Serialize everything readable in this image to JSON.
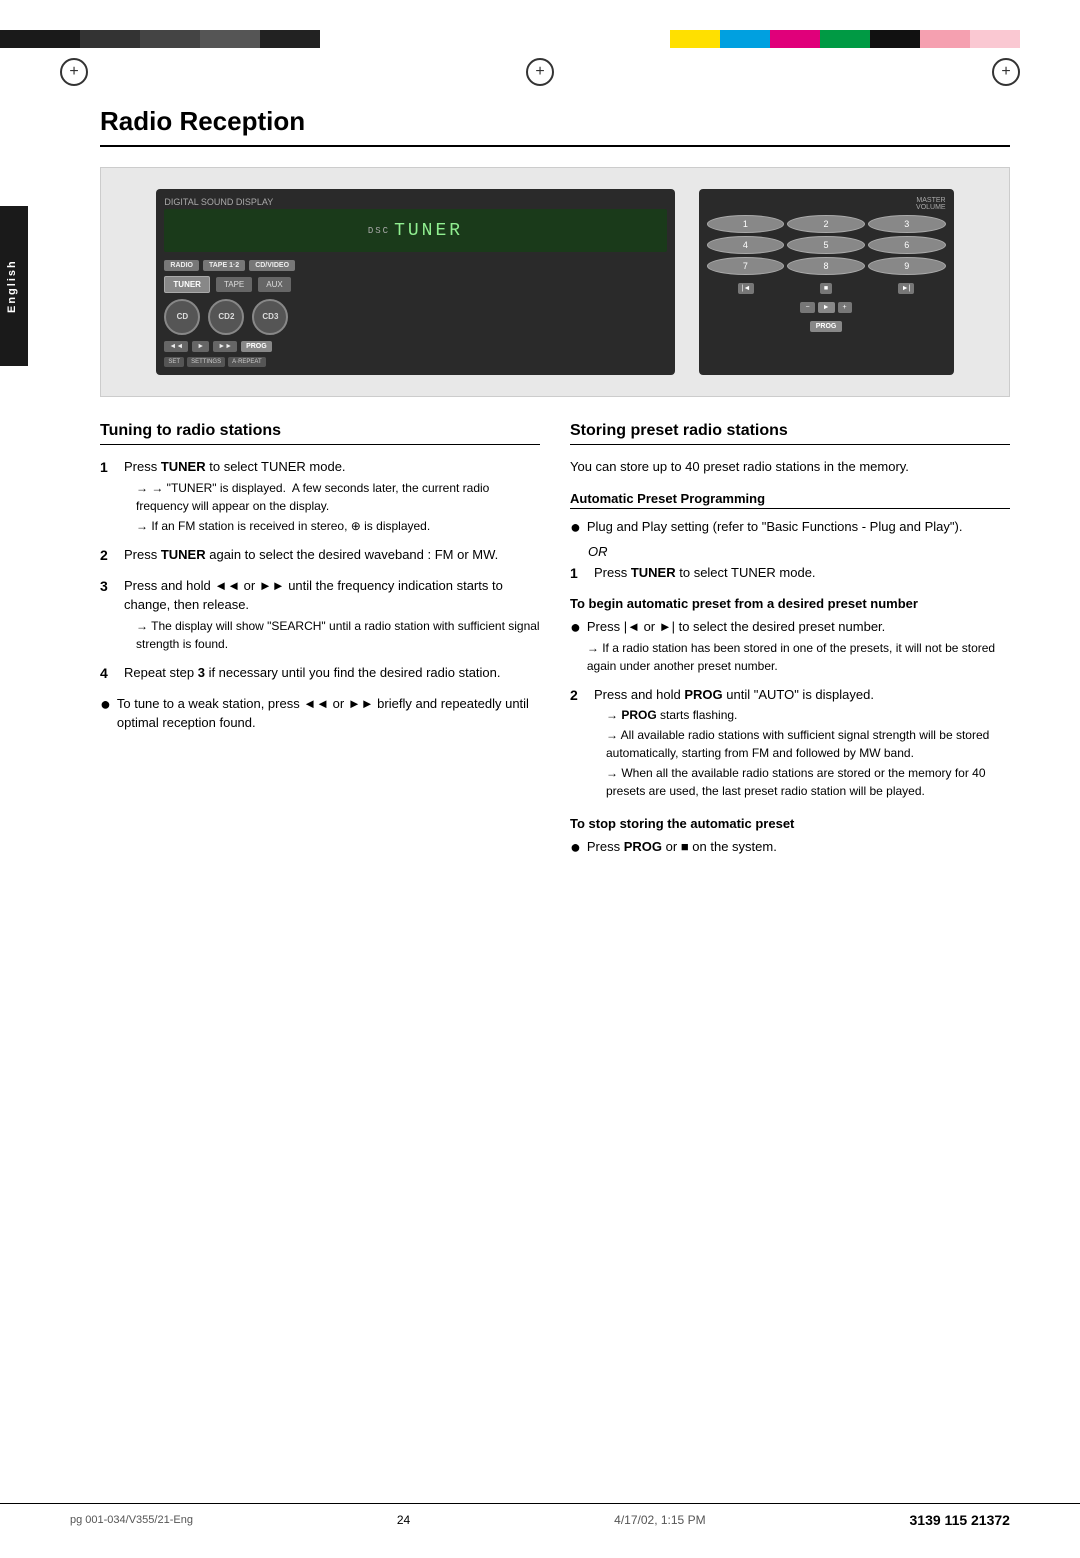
{
  "page": {
    "title": "Radio Reception",
    "language_label": "English",
    "footer": {
      "left": "pg 001-034/V355/21-Eng",
      "center": "24",
      "right": "3139 115 21372",
      "date": "4/17/02, 1:15 PM"
    }
  },
  "tuning_section": {
    "title": "Tuning to radio stations",
    "steps": [
      {
        "num": "1",
        "text": "Press TUNER to select TUNER mode.",
        "note": "\"TUNER\" is displayed.  A few seconds later, the current radio frequency will appear on the display.",
        "sub_note": "If an FM station is received in stereo, ⊕ is displayed."
      },
      {
        "num": "2",
        "text": "Press TUNER again to select the desired waveband : FM or MW."
      },
      {
        "num": "3",
        "text": "Press and hold ◄◄ or ►► until the frequency indication starts to change, then release.",
        "note": "The display will show \"SEARCH\" until a radio station with sufficient signal strength is found."
      },
      {
        "num": "4",
        "text": "Repeat step 3 if necessary until you find the desired radio station."
      }
    ],
    "bullet": "To tune to a weak station, press ◄◄ or ►► briefly and repeatedly until optimal reception found."
  },
  "storing_section": {
    "title": "Storing preset radio stations",
    "intro": "You can store up to 40 preset radio stations in the memory.",
    "auto_preset": {
      "subtitle": "Automatic Preset Programming",
      "bullet1": "Plug and Play setting (refer to \"Basic Functions - Plug and Play\").",
      "or": "OR",
      "step1_label": "1",
      "step1_text": "Press TUNER to select TUNER mode.",
      "begin_title": "To begin automatic preset from a desired preset number",
      "begin_bullet": "Press |◄ or ►| to select the desired preset number.",
      "begin_note1": "If a radio station has been stored in one of the presets, it will not be stored again under another preset number.",
      "step2_label": "2",
      "step2_text": "Press and hold PROG until \"AUTO\" is displayed.",
      "step2_note1": "PROG starts flashing.",
      "step2_note2": "All available radio stations with sufficient signal strength will be stored automatically, starting from FM and followed by MW band.",
      "step2_note3": "When all the available radio stations are stored or the memory for 40 presets are used, the last preset radio station will be played.",
      "stop_title": "To stop storing the automatic preset",
      "stop_bullet": "Press PROG or ■ on the system."
    }
  },
  "device": {
    "display_text": "TUNER",
    "label": "DSC"
  }
}
